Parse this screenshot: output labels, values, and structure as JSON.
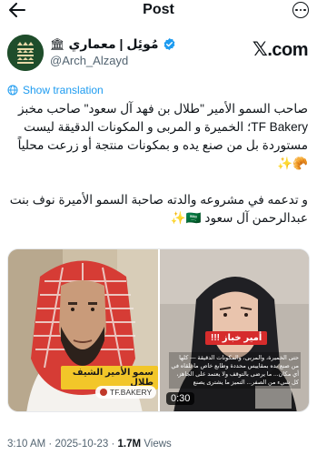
{
  "topbar": {
    "title": "Post"
  },
  "author": {
    "display_name": "مُوئِل | معماري",
    "org_emoji": "🏛",
    "handle": "@Arch_Alzayd"
  },
  "watermark": {
    "label": ".com"
  },
  "translate": {
    "label": "Show translation"
  },
  "post": {
    "text": "صاحب السمو الأمير \"طلال بن فهد آل سعود\" صاحب مخبز TF Bakery؛ الخميرة و المربى و المكونات الدقيقة ليست مستوردة بل من صنع يده و بمكونات منتجة أو زرعت محلياً 🥐✨\n\nو تدعمه في مشروعه والدته صاحبة السمو الأميرة نوف بنت عبدالرحمن آل سعود 🇸🇦✨"
  },
  "media": {
    "left": {
      "caption": "سمو الأمير الشيف طلال",
      "brand_tag": "TF.BAKERY"
    },
    "right": {
      "caption": "أمير خباز !!!",
      "subtitle": "حتى الخميرة، والمربى، والمكونات الدقيقة — كلها من صنع يده بمقاييس محددة وطابع خاص ما تلقاه في أي مكان... ما يرضى بالتوقف ولا يعتمد على الجاهز، كل شيء من الصفر... التميز ما يشترى يصنع",
      "duration": "0:30"
    }
  },
  "meta": {
    "time": "3:10 AM",
    "date": "2025-10-23",
    "views_count": "1.7M",
    "views_label": "Views",
    "separator": "·"
  },
  "colors": {
    "link": "#1d9bf0",
    "verified": "#1d9bf0",
    "avatar_bg": "#1f4d2b",
    "caption_yellow": "#f2c629",
    "caption_red": "#d62c2c"
  }
}
